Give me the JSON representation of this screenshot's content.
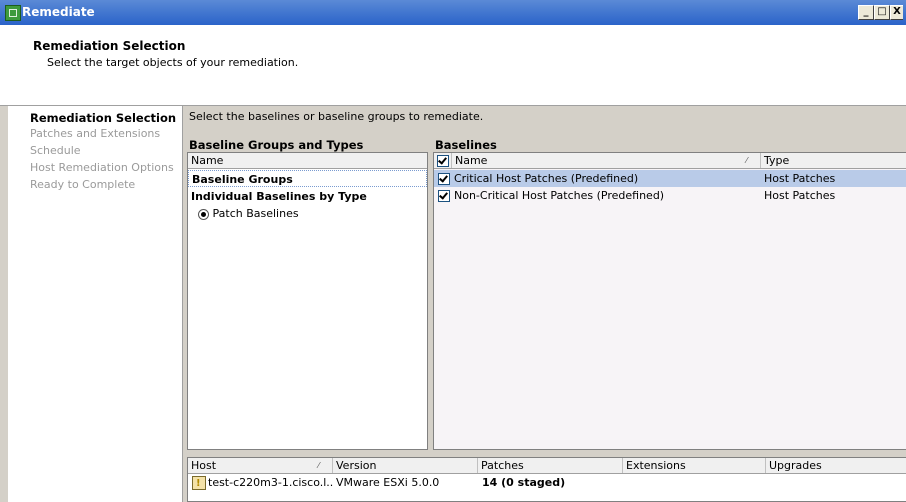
{
  "window": {
    "title": "Remediate"
  },
  "header": {
    "title": "Remediation Selection",
    "subtitle": "Select the target objects of your remediation."
  },
  "nav": {
    "items": [
      {
        "label": "Remediation Selection",
        "active": true
      },
      {
        "label": "Patches and Extensions",
        "active": false
      },
      {
        "label": "Schedule",
        "active": false
      },
      {
        "label": "Host Remediation Options",
        "active": false
      },
      {
        "label": "Ready to Complete",
        "active": false
      }
    ]
  },
  "main": {
    "instruction": "Select the baselines or baseline groups to remediate.",
    "groups": {
      "title": "Baseline Groups and Types",
      "column_name": "Name",
      "rows": {
        "baseline_groups": "Baseline Groups",
        "individual": "Individual Baselines by Type",
        "patch_baselines": "Patch Baselines"
      }
    },
    "baselines": {
      "title": "Baselines",
      "columns": {
        "name": "Name",
        "type": "Type"
      },
      "rows": [
        {
          "name": "Critical Host Patches (Predefined)",
          "type": "Host Patches",
          "checked": true,
          "selected": true
        },
        {
          "name": "Non-Critical Host Patches (Predefined)",
          "type": "Host Patches",
          "checked": true,
          "selected": false
        }
      ]
    },
    "hosts": {
      "columns": {
        "host": "Host",
        "version": "Version",
        "patches": "Patches",
        "extensions": "Extensions",
        "upgrades": "Upgrades"
      },
      "rows": [
        {
          "host": "test-c220m3-1.cisco.l..",
          "version": "VMware ESXi 5.0.0",
          "patches": "14 (0 staged)",
          "extensions": "",
          "upgrades": ""
        }
      ]
    }
  },
  "colors": {
    "titlebar": "#2a63c9",
    "selection": "#b9cbe8",
    "panel_bg": "#d4d0c8"
  }
}
